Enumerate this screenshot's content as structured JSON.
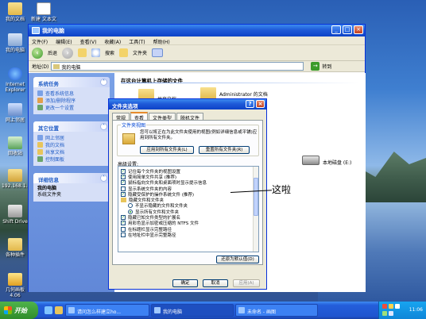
{
  "desktop": {
    "icons": [
      {
        "label": "我的文档"
      },
      {
        "label": "新建 文本文"
      },
      {
        "label": "我的电脑"
      },
      {
        "label": "Internet Explorer"
      },
      {
        "label": "网上邻居"
      },
      {
        "label": "回收站"
      },
      {
        "label": "192.168.1.1"
      },
      {
        "label": "Shift Drive"
      },
      {
        "label": "各种插件"
      },
      {
        "label": "几何画板 4.06"
      }
    ]
  },
  "explorer": {
    "title": "我的电脑",
    "menu": [
      "文件(F)",
      "编辑(E)",
      "查看(V)",
      "收藏(A)",
      "工具(T)",
      "帮助(H)"
    ],
    "toolbar": {
      "back": "后退",
      "search": "搜索",
      "folders": "文件夹"
    },
    "address": {
      "label": "地址(D)",
      "value": "我的电脑",
      "go": "转到"
    },
    "left_pane": {
      "system_tasks": {
        "title": "系统任务",
        "items": [
          "查看系统信息",
          "添加/删除程序",
          "更改一个设置"
        ]
      },
      "other_places": {
        "title": "其它位置",
        "items": [
          "网上邻居",
          "我的文档",
          "共享文档",
          "控制面板"
        ]
      },
      "details": {
        "title": "详细信息",
        "name": "我的电脑",
        "subtitle": "系统文件夹"
      }
    },
    "content": {
      "header": "在这台计算机上存储的文件",
      "folders": [
        "共享文档",
        "Administrator 的文档"
      ],
      "drive": "本地磁盘 (E:)"
    }
  },
  "dialog": {
    "title": "文件夹选项",
    "tabs": [
      "常规",
      "查看",
      "文件类型",
      "脱机文件"
    ],
    "folder_views": {
      "title": "文件夹视图",
      "text": "您可以将正在为此文件夹使用的视图(例如详细信息或平铺)应用到所有文件夹。",
      "apply_all": "应用到所有文件夹(L)",
      "reset_all": "重置所有文件夹(R)"
    },
    "advanced_label": "高级设置:",
    "advanced": [
      {
        "kind": "check",
        "checked": true,
        "text": "记住每个文件夹的视图设置"
      },
      {
        "kind": "check",
        "checked": true,
        "text": "使用简单文件共享 (推荐)"
      },
      {
        "kind": "check",
        "checked": true,
        "text": "鼠标指向文件夹和桌面项时显示提示信息"
      },
      {
        "kind": "check",
        "checked": false,
        "text": "显示系统文件夹的内容"
      },
      {
        "kind": "check",
        "checked": true,
        "text": "隐藏受保护的操作系统文件 (推荐)"
      },
      {
        "kind": "folder",
        "text": "隐藏文件和文件夹"
      },
      {
        "kind": "radio",
        "checked": false,
        "text": "不显示隐藏的文件和文件夹"
      },
      {
        "kind": "radio",
        "checked": true,
        "text": "显示所有文件和文件夹"
      },
      {
        "kind": "check",
        "checked": true,
        "text": "隐藏已知文件类型的扩展名"
      },
      {
        "kind": "check",
        "checked": true,
        "text": "用彩色显示加密或压缩的 NTFS 文件"
      },
      {
        "kind": "check",
        "checked": false,
        "text": "在标题栏显示完整路径"
      },
      {
        "kind": "check",
        "checked": false,
        "text": "在地址栏中显示完整路径"
      }
    ],
    "restore_defaults": "还原为默认值(D)",
    "ok": "确定",
    "cancel": "取消",
    "apply": "应用(A)"
  },
  "annotation": "这啦",
  "taskbar": {
    "start": "开始",
    "tasks": [
      "请问怎么样建立ho...",
      "我的电脑",
      "未命名 - 画图"
    ],
    "clock": "11:06"
  }
}
